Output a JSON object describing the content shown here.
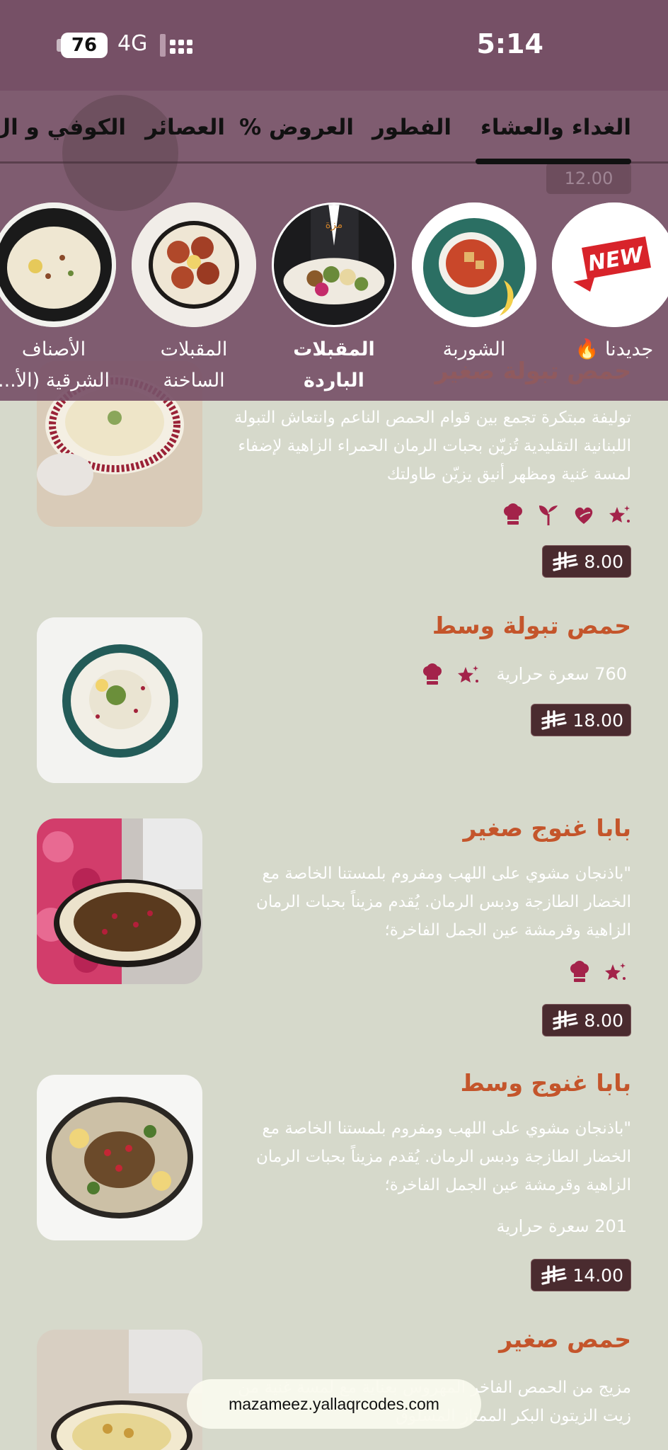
{
  "status_bar": {
    "time": "5:14",
    "battery": "76",
    "network": "4G"
  },
  "tabs": [
    {
      "label": "الغداء والعشاء",
      "active": true
    },
    {
      "label": "الفطور",
      "active": false
    },
    {
      "label": "العروض %",
      "active": false
    },
    {
      "label": "العصائر",
      "active": false
    },
    {
      "label": "الكوفي و ال",
      "active": false
    }
  ],
  "categories": [
    {
      "label": "جديدنا 🔥",
      "icon": "new-badge-icon"
    },
    {
      "label": "الشوربة",
      "icon": "soup-bowl-icon"
    },
    {
      "label": "المقبلات الباردة",
      "icon": "cold-appetizers-plate-icon",
      "active": true
    },
    {
      "label": "المقبلات الساخنة",
      "icon": "hot-appetizers-plate-icon"
    },
    {
      "label": "الأصناف الشرقية (الأ...",
      "icon": "rice-dish-icon"
    }
  ],
  "ghost": {
    "price": "12.00",
    "name": "حمص تبولة صغير"
  },
  "items": [
    {
      "name": "حمص تبولة صغير",
      "description": "توليفة مبتكرة تجمع بين قوام الحمص الناعم وانتعاش التبولة اللبنانية التقليدية تُزيّن بحبات الرمان الحمراء الزاهية لإضفاء لمسة غنية ومظهر أنيق يزيّن طاولتك",
      "calories": "",
      "tags": [
        "sparkle-star-icon",
        "heart-leaf-icon",
        "sprout-icon",
        "chef-hat-icon"
      ],
      "price": "8.00"
    },
    {
      "name": "حمص تبولة وسط",
      "description": "",
      "calories": "760 سعرة حرارية",
      "tags": [
        "sparkle-star-icon",
        "chef-hat-icon"
      ],
      "price": "18.00"
    },
    {
      "name": "بابا غنوج صغير",
      "description": "\"باذنجان مشوي على اللهب ومفروم بلمستنا الخاصة مع الخضار الطازجة ودبس الرمان. يُقدم مزيناً بحبات الرمان الزاهية وقرمشة عين الجمل الفاخرة؛",
      "calories": "",
      "tags": [
        "sparkle-star-icon",
        "chef-hat-icon"
      ],
      "price": "8.00"
    },
    {
      "name": "بابا غنوج وسط",
      "description": "\"باذنجان مشوي على اللهب ومفروم بلمستنا الخاصة مع الخضار الطازجة ودبس الرمان. يُقدم مزيناً بحبات الرمان الزاهية وقرمشة عين الجمل الفاخرة؛",
      "calories": "201 سعرة حرارية",
      "tags": [],
      "price": "14.00"
    },
    {
      "name": "حمص صغير",
      "description": "مزيج من الحمص الفاخر المهروس بعناية مع لمسة غنية من زيت الزيتون البكر الممتاز المسلوق",
      "calories": "",
      "tags": [],
      "price": ""
    }
  ],
  "url_bar": {
    "text": "mazameez.yallaqrcodes.com"
  },
  "colors": {
    "background": "#d6d9cb",
    "item_title": "#c4552b",
    "price_bg": "#4a2b2f",
    "overlay": "#785268",
    "tag_icon": "#a3234a"
  }
}
